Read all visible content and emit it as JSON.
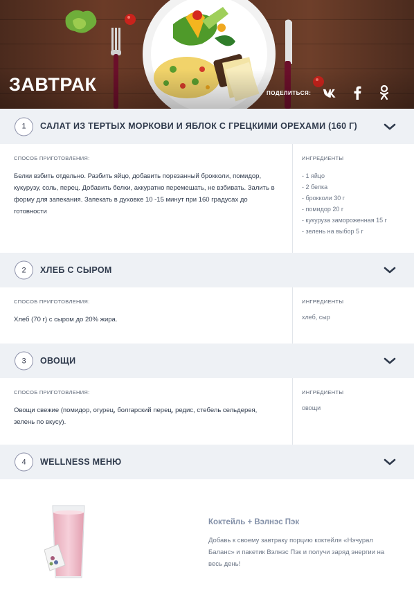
{
  "hero": {
    "title": "ЗАВТРАК",
    "share_label": "ПОДЕЛИТЬСЯ:",
    "share_icons": [
      "vk-icon",
      "facebook-icon",
      "odnoklassniki-icon"
    ]
  },
  "labels": {
    "method": "СПОСОБ ПРИГОТОВЛЕНИЯ:",
    "ingredients": "ИНГРЕДИЕНТЫ"
  },
  "sections": [
    {
      "number": "1",
      "title": "САЛАТ ИЗ ТЕРТЫХ МОРКОВИ И ЯБЛОК С ГРЕЦКИМИ ОРЕХАМИ (160 Г)",
      "method": "Белки взбить отдельно. Разбить яйцо, добавить порезанный брокколи, помидор, кукурузу, соль, перец. Добавить белки, аккуратно перемешать, не взбивать. Залить в форму для запекания. Запекать в духовке 10 -15 минут при 160 градусах до готовности",
      "ingredients": [
        "- 1 яйцо",
        "- 2 белка",
        "- брокколи 30 г",
        "- помидор 20 г",
        "- кукуруза замороженная 15 г",
        "- зелень на выбор 5 г"
      ]
    },
    {
      "number": "2",
      "title": "ХЛЕБ С СЫРОМ",
      "method": "Хлеб (70 г) с сыром до 20% жира.",
      "ingredients": [
        "хлеб, сыр"
      ]
    },
    {
      "number": "3",
      "title": "ОВОЩИ",
      "method": "Овощи свежие (помидор, огурец, болгарский перец, редис, стебель сельдерея, зелень по вкусу).",
      "ingredients": [
        "овощи"
      ]
    },
    {
      "number": "4",
      "title": "WELLNESS МЕНЮ"
    }
  ],
  "wellness": {
    "title": "Коктейль + Вэлнэс Пэк",
    "text": "Добавь к своему завтраку порцию коктейля «Нэчурал Баланс» и пакетик Вэлнэс Пэк и получи заряд энергии на весь день!"
  },
  "colors": {
    "header_bg": "#eef1f5",
    "text": "#2f3a4c",
    "muted": "#6c7686",
    "accent": "#8390a8"
  }
}
